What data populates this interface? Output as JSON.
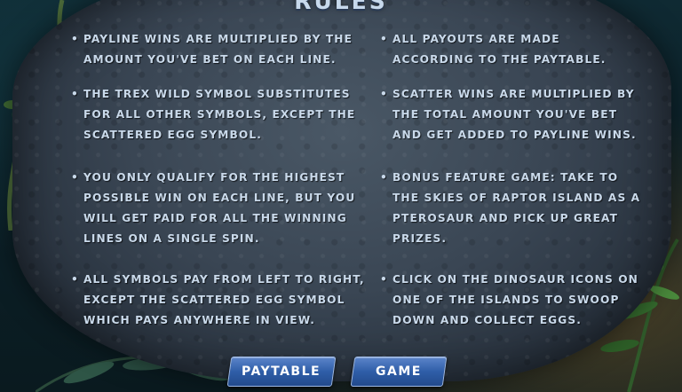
{
  "title": "RULES",
  "rules_left": [
    {
      "bullet": "•",
      "text": "PAYLINE WINS ARE MULTIPLIED BY THE\nAMOUNT YOU'VE BET  ON EACH LINE."
    },
    {
      "bullet": "•",
      "text": "THE TREX WILD SYMBOL SUBSTITUTES\nFOR ALL OTHER SYMBOLS, EXCEPT THE\nSCATTERED EGG SYMBOL."
    },
    {
      "bullet": "•",
      "text": "YOU ONLY QUALIFY FOR THE HIGHEST\nPOSSIBLE WIN ON EACH  LINE, BUT YOU\nWILL GET PAID FOR ALL THE WINNING\nLINES ON  A SINGLE SPIN."
    },
    {
      "bullet": "•",
      "text": "ALL SYMBOLS PAY FROM LEFT TO RIGHT,\nEXCEPT THE  SCATTERED EGG SYMBOL\nWHICH PAYS ANYWHERE IN VIEW."
    }
  ],
  "rules_right": [
    {
      "bullet": "•",
      "text": "ALL PAYOUTS ARE MADE\nACCORDING TO THE PAYTABLE."
    },
    {
      "bullet": "•",
      "text": "SCATTER WINS ARE MULTIPLIED BY\nTHE TOTAL AMOUNT YOU'VE  BET\nAND GET ADDED TO PAYLINE WINS."
    },
    {
      "bullet": "•",
      "text": "BONUS FEATURE GAME: TAKE TO\nTHE SKIES OF RAPTOR ISLAND AS A\nPTEROSAUR AND PICK UP GREAT\nPRIZES."
    },
    {
      "bullet": "•",
      "text": "CLICK ON THE DINOSAUR ICONS ON\nONE OF THE ISLANDS TO SWOOP\nDOWN AND COLLECT EGGS."
    }
  ],
  "buttons": {
    "paytable": "PAYTABLE",
    "game": "GAME"
  },
  "colors": {
    "text": "#c9d9ea",
    "button": "#2f5ea8",
    "rock": "#3a4654"
  }
}
